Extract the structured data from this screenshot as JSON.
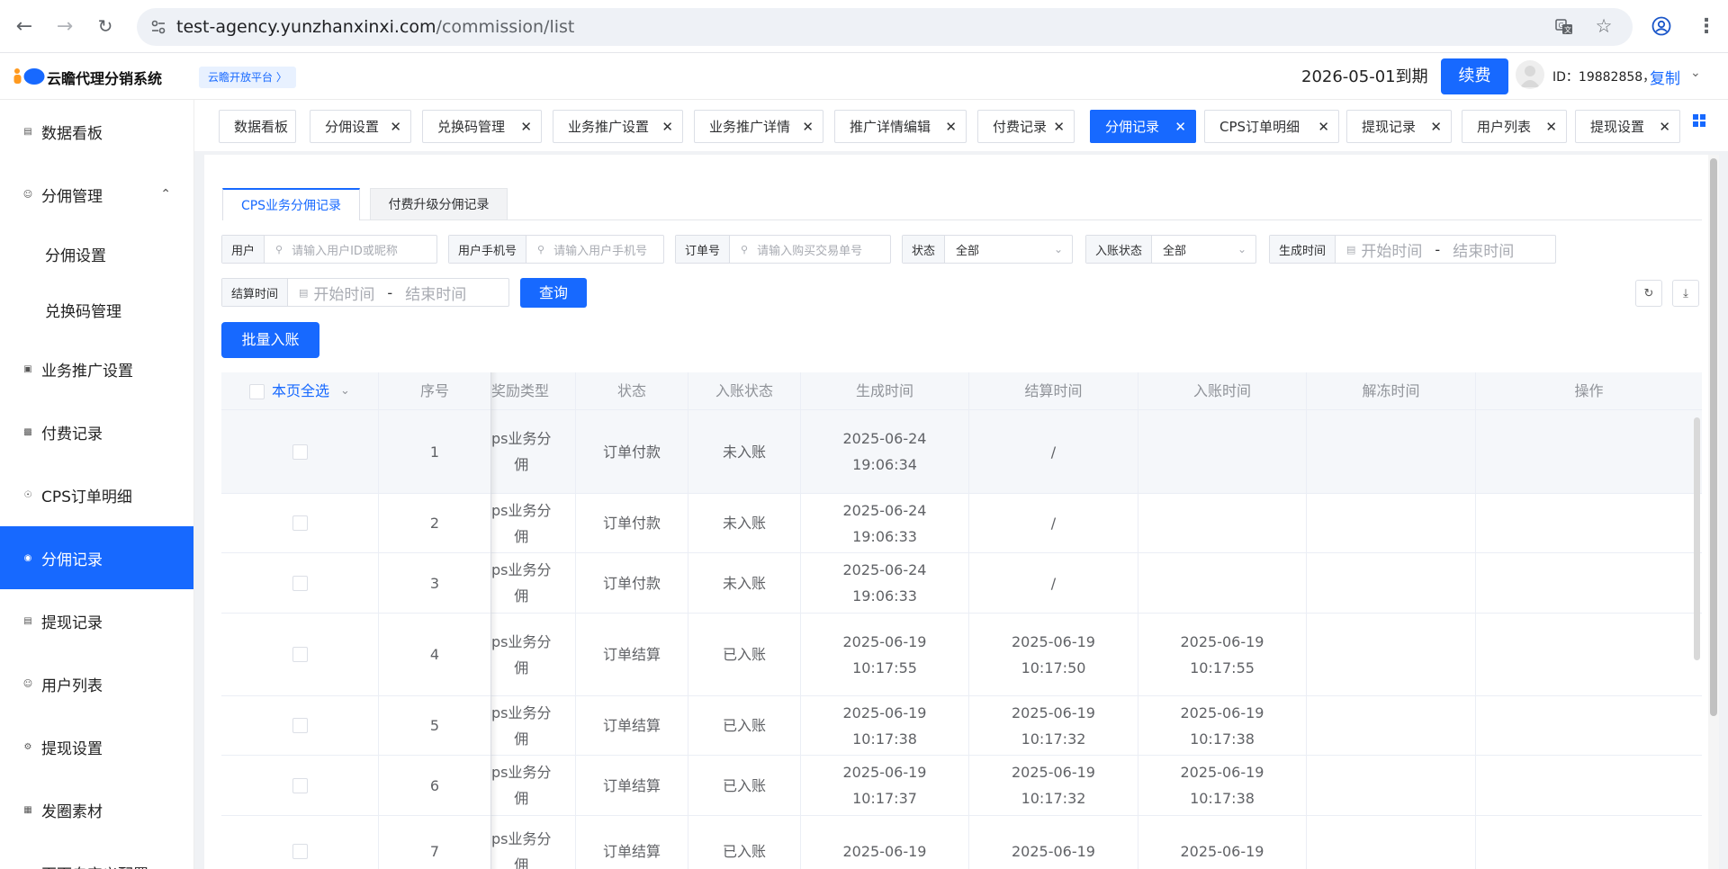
{
  "browser": {
    "url_host": "test-agency.yunzhanxinxi.com",
    "url_path": "/commission/list"
  },
  "header": {
    "app_title": "云瞻代理分销系统",
    "platform_tag": "云瞻开放平台 〉",
    "expire_text": "2026-05-01到期",
    "renew_label": "续费",
    "user_id": "ID：19882858，",
    "copy_label": "复制",
    "brand_color": "#1769ff"
  },
  "sidebar": {
    "items": [
      {
        "label": "数据看板",
        "icon": "dashboard-icon"
      },
      {
        "label": "分佣管理",
        "icon": "user-icon"
      },
      {
        "label": "分佣设置"
      },
      {
        "label": "兑换码管理"
      },
      {
        "label": "业务推广设置",
        "icon": "briefcase-icon"
      },
      {
        "label": "付费记录",
        "icon": "record-icon"
      },
      {
        "label": "CPS订单明细",
        "icon": "order-icon"
      },
      {
        "label": "分佣记录",
        "icon": "target-icon"
      },
      {
        "label": "提现记录",
        "icon": "document-icon"
      },
      {
        "label": "用户列表",
        "icon": "user-icon"
      },
      {
        "label": "提现设置",
        "icon": "settings-icon"
      },
      {
        "label": "发圈素材",
        "icon": "material-icon"
      },
      {
        "label": "页面自定义配置",
        "icon": "page-icon"
      }
    ]
  },
  "tabs": [
    {
      "label": "数据看板"
    },
    {
      "label": "分佣设置"
    },
    {
      "label": "兑换码管理"
    },
    {
      "label": "业务推广设置"
    },
    {
      "label": "业务推广详情"
    },
    {
      "label": "推广详情编辑"
    },
    {
      "label": "付费记录"
    },
    {
      "label": "分佣记录"
    },
    {
      "label": "CPS订单明细"
    },
    {
      "label": "提现记录"
    },
    {
      "label": "用户列表"
    },
    {
      "label": "提现设置"
    }
  ],
  "subtabs": {
    "cps": "CPS业务分佣记录",
    "upgrade": "付费升级分佣记录"
  },
  "filters": {
    "user_label": "用户",
    "user_placeholder": "请输入用户ID或昵称",
    "phone_label": "用户手机号",
    "phone_placeholder": "请输入用户手机号",
    "order_label": "订单号",
    "order_placeholder": "请输入购买交易单号",
    "status_label": "状态",
    "status_value": "全部",
    "account_status_label": "入账状态",
    "account_status_value": "全部",
    "created_label": "生成时间",
    "settle_label": "结算时间",
    "start_placeholder": "开始时间",
    "end_placeholder": "结束时间",
    "range_separator": "-",
    "query_label": "查询"
  },
  "batch_label": "批量入账",
  "table": {
    "select_all": "本页全选",
    "columns": [
      "序号",
      "奖励类型",
      "状态",
      "入账状态",
      "生成时间",
      "结算时间",
      "入账时间",
      "解冻时间",
      "操作"
    ],
    "rows": [
      {
        "no": "1",
        "type1": "ps业务分",
        "type2": "佣",
        "status": "订单付款",
        "account": "未入账",
        "created1": "2025-06-24",
        "created2": "19:06:34",
        "settle1": "/",
        "settle2": "",
        "posted1": "",
        "posted2": ""
      },
      {
        "no": "2",
        "type1": "ps业务分",
        "type2": "佣",
        "status": "订单付款",
        "account": "未入账",
        "created1": "2025-06-24",
        "created2": "19:06:33",
        "settle1": "/",
        "settle2": "",
        "posted1": "",
        "posted2": ""
      },
      {
        "no": "3",
        "type1": "ps业务分",
        "type2": "佣",
        "status": "订单付款",
        "account": "未入账",
        "created1": "2025-06-24",
        "created2": "19:06:33",
        "settle1": "/",
        "settle2": "",
        "posted1": "",
        "posted2": ""
      },
      {
        "no": "4",
        "type1": "ps业务分",
        "type2": "佣",
        "status": "订单结算",
        "account": "已入账",
        "created1": "2025-06-19",
        "created2": "10:17:55",
        "settle1": "2025-06-19",
        "settle2": "10:17:50",
        "posted1": "2025-06-19",
        "posted2": "10:17:55"
      },
      {
        "no": "5",
        "type1": "ps业务分",
        "type2": "佣",
        "status": "订单结算",
        "account": "已入账",
        "created1": "2025-06-19",
        "created2": "10:17:38",
        "settle1": "2025-06-19",
        "settle2": "10:17:32",
        "posted1": "2025-06-19",
        "posted2": "10:17:38"
      },
      {
        "no": "6",
        "type1": "ps业务分",
        "type2": "佣",
        "status": "订单结算",
        "account": "已入账",
        "created1": "2025-06-19",
        "created2": "10:17:37",
        "settle1": "2025-06-19",
        "settle2": "10:17:32",
        "posted1": "2025-06-19",
        "posted2": "10:17:38"
      },
      {
        "no": "7",
        "type1": "ps业务分",
        "type2": "佣",
        "status": "订单结算",
        "account": "已入账",
        "created1": "2025-06-19",
        "created2": "",
        "settle1": "2025-06-19",
        "settle2": "",
        "posted1": "2025-06-19",
        "posted2": ""
      }
    ]
  }
}
